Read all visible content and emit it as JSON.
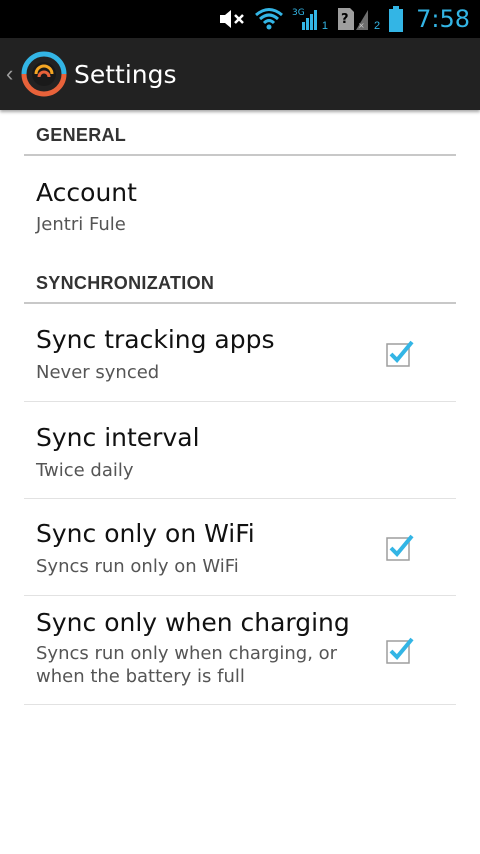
{
  "status_bar": {
    "time": "7:58",
    "network_label": "3G",
    "sim1": "1",
    "sim2": "2",
    "icons": [
      "mute-icon",
      "wifi-icon",
      "signal-icon",
      "no-sim-icon",
      "battery-icon"
    ]
  },
  "action_bar": {
    "title": "Settings",
    "back_glyph": "‹"
  },
  "sections": {
    "general": {
      "header": "GENERAL",
      "account_title": "Account",
      "account_summary": "Jentri Fule"
    },
    "sync": {
      "header": "SYNCHRONIZATION",
      "items": [
        {
          "title": "Sync tracking apps",
          "summary": "Never synced",
          "checked": true
        },
        {
          "title": "Sync interval",
          "summary": "Twice daily"
        },
        {
          "title": "Sync only on WiFi",
          "summary": "Syncs run only on WiFi",
          "checked": true
        },
        {
          "title": "Sync only when charging",
          "summary": "Syncs run only when charging, or when the battery is full",
          "checked": true
        }
      ]
    }
  },
  "colors": {
    "accent": "#33b5e5",
    "action_bar": "#222222",
    "status_bar": "#000000"
  }
}
